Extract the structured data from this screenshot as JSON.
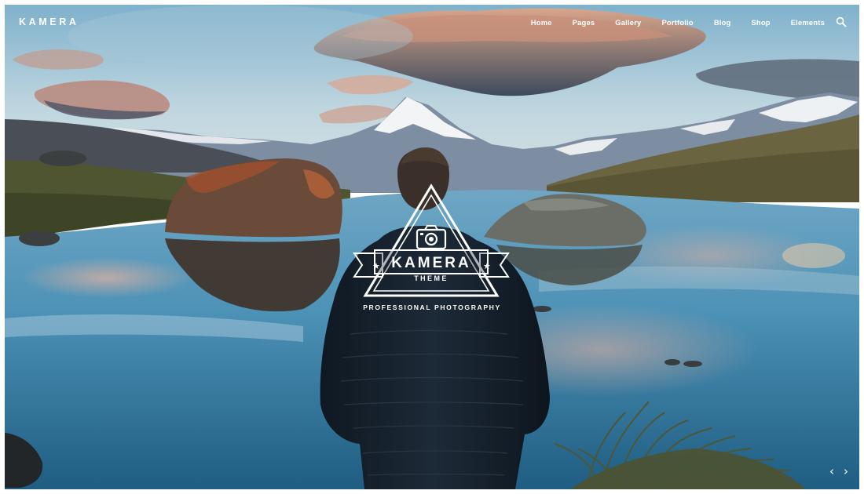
{
  "header": {
    "brand": "KAMERA",
    "nav": [
      {
        "label": "Home"
      },
      {
        "label": "Pages"
      },
      {
        "label": "Gallery"
      },
      {
        "label": "Portfolio"
      },
      {
        "label": "Blog"
      },
      {
        "label": "Shop"
      },
      {
        "label": "Elements"
      }
    ],
    "search_icon": "search-icon"
  },
  "hero": {
    "logo_word": "KAMERA",
    "logo_sub": "THEME",
    "tagline": "PROFESSIONAL PHOTOGRAPHY",
    "logo_icon": "camera-icon",
    "slider": {
      "prev_icon": "chevron-left-icon",
      "next_icon": "chevron-right-icon"
    }
  },
  "colors": {
    "text": "#ffffff",
    "sky": "#9ec4d6",
    "water": "#4b93b8",
    "jacket": "#15202b"
  }
}
